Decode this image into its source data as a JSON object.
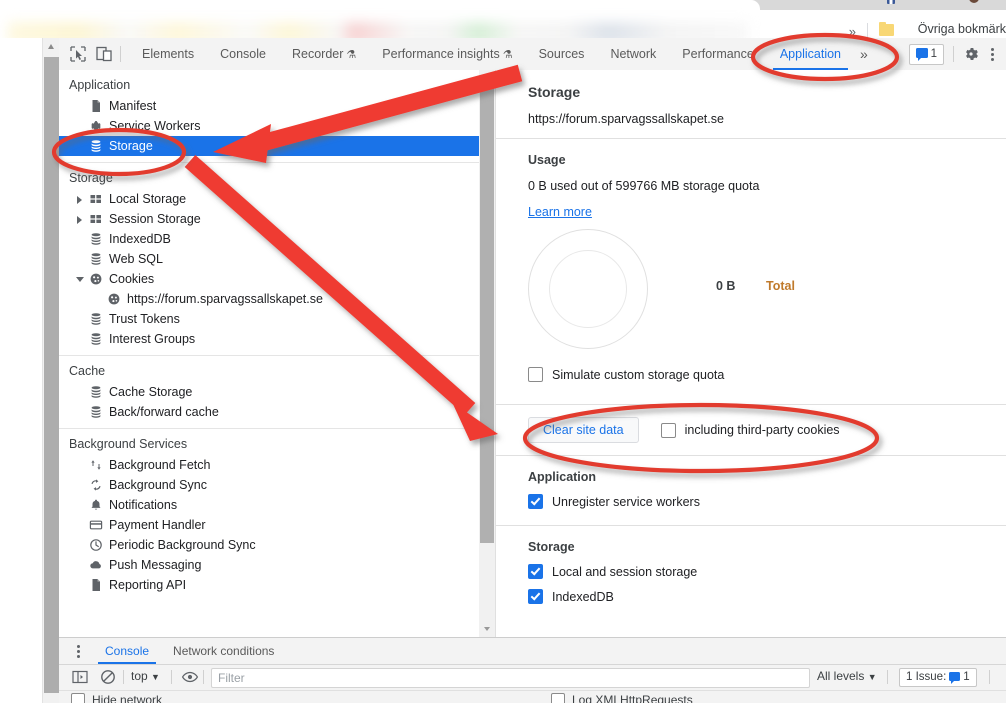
{
  "browser": {
    "bookmark_overflow": "»",
    "other_bookmarks_icon": "folder-icon",
    "other_bookmarks_label": "Övriga bokmärk"
  },
  "devtools": {
    "toolbar": {
      "inspect_icon": "inspect-element-icon",
      "device_toolbar_icon": "device-toolbar-icon",
      "tabs": [
        {
          "label": "Elements",
          "active": false,
          "experiment": false
        },
        {
          "label": "Console",
          "active": false,
          "experiment": false
        },
        {
          "label": "Recorder",
          "active": false,
          "experiment": true
        },
        {
          "label": "Performance insights",
          "active": false,
          "experiment": true
        },
        {
          "label": "Sources",
          "active": false,
          "experiment": false
        },
        {
          "label": "Network",
          "active": false,
          "experiment": false
        },
        {
          "label": "Performance",
          "active": false,
          "experiment": false
        },
        {
          "label": "Application",
          "active": true,
          "experiment": false
        }
      ],
      "overflow_label": "»",
      "experiment_glyph": "⚗",
      "issues_count": "1",
      "settings_icon": "gear-icon",
      "more_icon": "kebab-menu-icon"
    },
    "sidebar": {
      "groups": [
        {
          "header": "Application",
          "items": [
            {
              "label": "Manifest",
              "icon": "document-icon",
              "indent": 1,
              "twisty": "none",
              "selected": false
            },
            {
              "label": "Service Workers",
              "icon": "gear-icon",
              "indent": 1,
              "twisty": "none",
              "selected": false
            },
            {
              "label": "Storage",
              "icon": "database-icon",
              "indent": 1,
              "twisty": "none",
              "selected": true
            }
          ]
        },
        {
          "header": "Storage",
          "items": [
            {
              "label": "Local Storage",
              "icon": "table-icon",
              "indent": 1,
              "twisty": "closed",
              "selected": false
            },
            {
              "label": "Session Storage",
              "icon": "table-icon",
              "indent": 1,
              "twisty": "closed",
              "selected": false
            },
            {
              "label": "IndexedDB",
              "icon": "database-icon",
              "indent": 1,
              "twisty": "none",
              "selected": false
            },
            {
              "label": "Web SQL",
              "icon": "database-icon",
              "indent": 1,
              "twisty": "none",
              "selected": false
            },
            {
              "label": "Cookies",
              "icon": "cookie-icon",
              "indent": 1,
              "twisty": "open",
              "selected": false
            },
            {
              "label": "https://forum.sparvagssallskapet.se",
              "icon": "cookie-icon",
              "indent": 2,
              "twisty": "none",
              "selected": false
            },
            {
              "label": "Trust Tokens",
              "icon": "database-icon",
              "indent": 1,
              "twisty": "none",
              "selected": false
            },
            {
              "label": "Interest Groups",
              "icon": "database-icon",
              "indent": 1,
              "twisty": "none",
              "selected": false
            }
          ]
        },
        {
          "header": "Cache",
          "items": [
            {
              "label": "Cache Storage",
              "icon": "database-icon",
              "indent": 1,
              "twisty": "none",
              "selected": false
            },
            {
              "label": "Back/forward cache",
              "icon": "database-icon",
              "indent": 1,
              "twisty": "none",
              "selected": false
            }
          ]
        },
        {
          "header": "Background Services",
          "items": [
            {
              "label": "Background Fetch",
              "icon": "updown-arrows-icon",
              "indent": 1,
              "twisty": "none",
              "selected": false
            },
            {
              "label": "Background Sync",
              "icon": "sync-icon",
              "indent": 1,
              "twisty": "none",
              "selected": false
            },
            {
              "label": "Notifications",
              "icon": "bell-icon",
              "indent": 1,
              "twisty": "none",
              "selected": false
            },
            {
              "label": "Payment Handler",
              "icon": "credit-card-icon",
              "indent": 1,
              "twisty": "none",
              "selected": false
            },
            {
              "label": "Periodic Background Sync",
              "icon": "clock-icon",
              "indent": 1,
              "twisty": "none",
              "selected": false
            },
            {
              "label": "Push Messaging",
              "icon": "cloud-icon",
              "indent": 1,
              "twisty": "none",
              "selected": false
            },
            {
              "label": "Reporting API",
              "icon": "document-icon",
              "indent": 1,
              "twisty": "none",
              "selected": false
            }
          ]
        }
      ]
    },
    "main": {
      "title": "Storage",
      "origin_url": "https://forum.sparvagssallskapet.se",
      "usage_heading": "Usage",
      "usage_text": "0 B used out of 599766 MB storage quota",
      "learn_more": "Learn more",
      "donut_value": "0 B",
      "donut_legend": "Total",
      "simulate_quota_label": "Simulate custom storage quota",
      "simulate_quota_checked": false,
      "clear_button": "Clear site data",
      "third_party_label": "including third-party cookies",
      "third_party_checked": false,
      "application_heading": "Application",
      "unregister_label": "Unregister service workers",
      "unregister_checked": true,
      "storage_heading": "Storage",
      "local_session_label": "Local and session storage",
      "local_session_checked": true,
      "indexeddb_label": "IndexedDB",
      "indexeddb_checked": true
    },
    "drawer": {
      "more_icon": "kebab-menu-icon",
      "tabs": [
        {
          "label": "Console",
          "active": true
        },
        {
          "label": "Network conditions",
          "active": false
        }
      ],
      "sidebar_icon": "console-sidebar-icon",
      "clear_icon": "clear-console-icon",
      "context": "top",
      "context_caret": "▼",
      "eye_icon": "live-expression-icon",
      "filter_placeholder": "Filter",
      "levels": "All levels",
      "levels_caret": "▼",
      "issues_label": "1 Issue:",
      "issues_count": "1",
      "hide_network_label": "Hide network",
      "hide_network_checked": false,
      "log_xhr_label": "Log XMLHttpRequests",
      "log_xhr_checked": false
    }
  },
  "annotations": {
    "color": "#e8392c",
    "ellipses": [
      {
        "name": "application-tab-highlight"
      },
      {
        "name": "storage-sidebar-item-highlight"
      },
      {
        "name": "clear-site-data-highlight"
      }
    ],
    "arrows": [
      {
        "name": "arrow-application-tab-to-storage-item"
      },
      {
        "name": "arrow-storage-item-to-clear-site-data"
      }
    ]
  }
}
